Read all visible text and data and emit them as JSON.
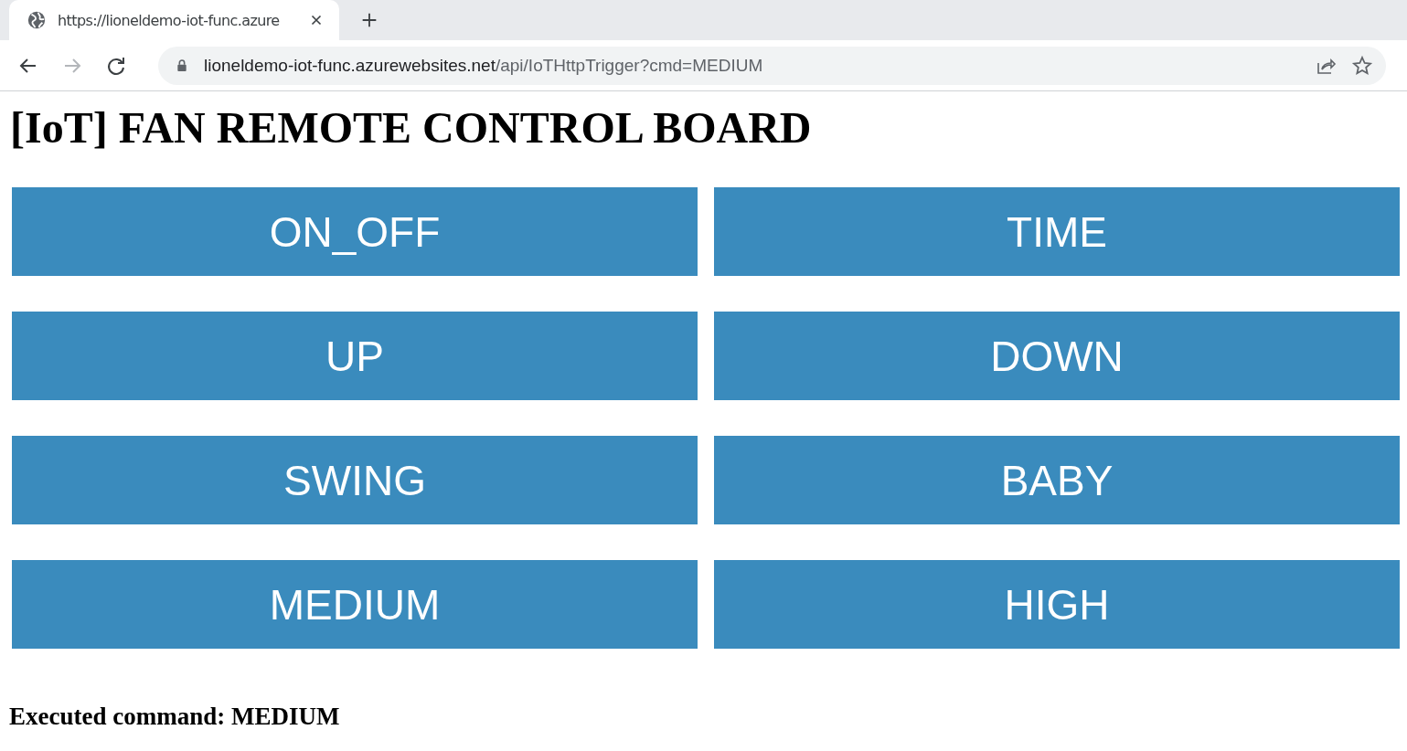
{
  "browser": {
    "tab": {
      "title": "https://lioneldemo-iot-func.azure",
      "selected": true
    },
    "back": {
      "disabled": false
    },
    "forward": {
      "disabled": true
    },
    "address": {
      "host": "lioneldemo-iot-func.azurewebsites.net",
      "path": "/api/IoTHttpTrigger?cmd=MEDIUM"
    }
  },
  "page": {
    "heading": "[IoT] FAN REMOTE CONTROL BOARD",
    "buttons": [
      {
        "label": "ON_OFF"
      },
      {
        "label": "TIME"
      },
      {
        "label": "UP"
      },
      {
        "label": "DOWN"
      },
      {
        "label": "SWING"
      },
      {
        "label": "BABY"
      },
      {
        "label": "MEDIUM"
      },
      {
        "label": "HIGH"
      }
    ],
    "result": "Executed command: MEDIUM"
  }
}
